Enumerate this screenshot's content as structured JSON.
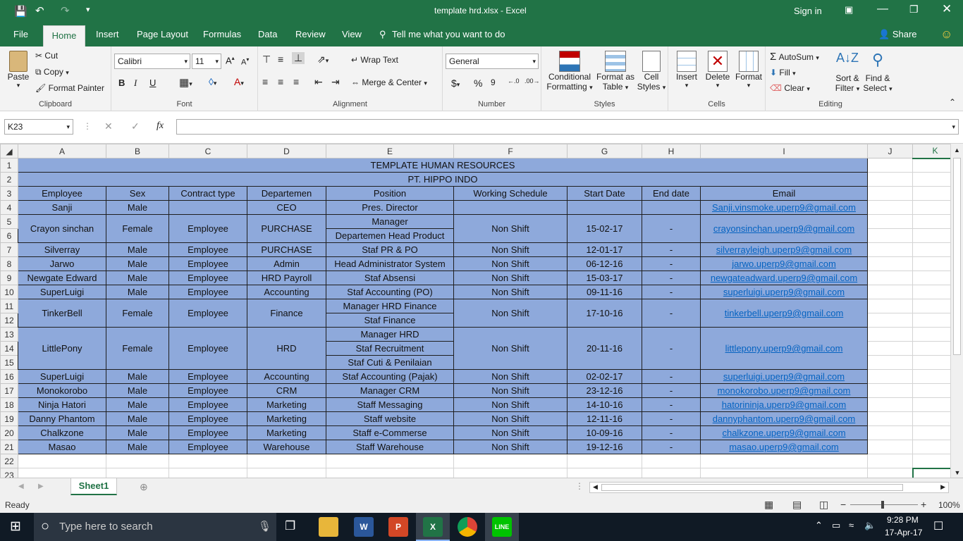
{
  "window": {
    "title": "template hrd.xlsx  -  Excel",
    "sign_in": "Sign in"
  },
  "tabs": [
    "File",
    "Home",
    "Insert",
    "Page Layout",
    "Formulas",
    "Data",
    "Review",
    "View"
  ],
  "tell_me": "Tell me what you want to do",
  "share": "Share",
  "ribbon": {
    "clipboard": {
      "label": "Clipboard",
      "paste": "Paste",
      "cut": "Cut",
      "copy": "Copy",
      "format_painter": "Format Painter"
    },
    "font": {
      "label": "Font",
      "name": "Calibri",
      "size": "11",
      "bold": "B",
      "italic": "I",
      "underline": "U"
    },
    "alignment": {
      "label": "Alignment",
      "wrap": "Wrap Text",
      "merge": "Merge & Center"
    },
    "number": {
      "label": "Number",
      "format": "General",
      "currency": "$",
      "percent": "%",
      "comma": "9"
    },
    "styles": {
      "label": "Styles",
      "conditional": "Conditional",
      "conditional2": "Formatting",
      "format_table": "Format as",
      "format_table2": "Table",
      "cell_styles": "Cell",
      "cell_styles2": "Styles"
    },
    "cells": {
      "label": "Cells",
      "insert": "Insert",
      "delete": "Delete",
      "format": "Format"
    },
    "editing": {
      "label": "Editing",
      "autosum": "AutoSum",
      "fill": "Fill",
      "clear": "Clear",
      "sort": "Sort &",
      "sort2": "Filter",
      "find": "Find &",
      "find2": "Select"
    }
  },
  "namebox": "K23",
  "fx": "fx",
  "columns": [
    "A",
    "B",
    "C",
    "D",
    "E",
    "F",
    "G",
    "H",
    "I",
    "J",
    "K"
  ],
  "sheet": {
    "title": "TEMPLATE HUMAN RESOURCES",
    "company": "PT. HIPPO INDO",
    "headers": [
      "Employee",
      "Sex",
      "Contract type",
      "Departemen",
      "Position",
      "Working Schedule",
      "Start Date",
      "End date",
      "Email"
    ],
    "r4": [
      "Sanji",
      "Male",
      "",
      "CEO",
      "Pres. Director",
      "",
      "",
      "",
      "Sanji.vinsmoke.uperp9@gmail.com"
    ],
    "r5": [
      "Crayon sinchan",
      "Female",
      "Employee",
      "PURCHASE",
      "Manager",
      "Non Shift",
      "15-02-17",
      "-",
      "crayonsinchan.uperp9@gmail.com"
    ],
    "r6pos": "Departemen Head Product",
    "r7": [
      "Silverray",
      "Male",
      "Employee",
      "PURCHASE",
      "Staf PR & PO",
      "Non Shift",
      "12-01-17",
      "-",
      "silverrayleigh.uperp9@gmail.com"
    ],
    "r8": [
      "Jarwo",
      "Male",
      "Employee",
      "Admin",
      "Head Administrator System",
      "Non Shift",
      "06-12-16",
      "-",
      "jarwo.uperp9@gmail.com"
    ],
    "r9": [
      "Newgate Edward",
      "Male",
      "Employee",
      "HRD Payroll",
      "Staf Absensi",
      "Non Shift",
      "15-03-17",
      "-",
      "newgateadward.uperp9@gmail.com"
    ],
    "r10": [
      "SuperLuigi",
      "Male",
      "Employee",
      "Accounting",
      "Staf Accounting (PO)",
      "Non Shift",
      "09-11-16",
      "-",
      "superluigi.uperp9@gmail.com"
    ],
    "r11": [
      "TinkerBell",
      "Female",
      "Employee",
      "Finance",
      "Manager HRD Finance",
      "Non Shift",
      "17-10-16",
      "-",
      "tinkerbell.uperp9@gmail.com"
    ],
    "r12pos": "Staf Finance",
    "r13": [
      "LittlePony",
      "Female",
      "Employee",
      "HRD",
      "Manager HRD",
      "Non Shift",
      "20-11-16",
      "-",
      "littlepony.uperp9@gmail.com"
    ],
    "r14pos": "Staf Recruitment",
    "r15pos": "Staf Cuti & Penilaian",
    "r16": [
      "SuperLuigi",
      "Male",
      "Employee",
      "Accounting",
      "Staf Accounting (Pajak)",
      "Non Shift",
      "02-02-17",
      "-",
      "superluigi.uperp9@gmail.com"
    ],
    "r17": [
      "Monokorobo",
      "Male",
      "Employee",
      "CRM",
      "Manager CRM",
      "Non Shift",
      "23-12-16",
      "-",
      "monokorobo.uperp9@gmail.com"
    ],
    "r18": [
      "Ninja Hatori",
      "Male",
      "Employee",
      "Marketing",
      "Staff Messaging",
      "Non Shift",
      "14-10-16",
      "-",
      "hatorininja.uperp9@gmail.com"
    ],
    "r19": [
      "Danny Phantom",
      "Male",
      "Employee",
      "Marketing",
      "Staff website",
      "Non Shift",
      "12-11-16",
      "-",
      "dannyphantom.uperp9@gmail.com"
    ],
    "r20": [
      "Chalkzone",
      "Male",
      "Employee",
      "Marketing",
      "Staff e-Commerse",
      "Non Shift",
      "10-09-16",
      "-",
      "chalkzone.uperp9@gmail.com"
    ],
    "r21": [
      "Masao",
      "Male",
      "Employee",
      "Warehouse",
      "Staff Warehouse",
      "Non Shift",
      "19-12-16",
      "-",
      "masao.uperp9@gmail.com"
    ]
  },
  "sheet_tab": "Sheet1",
  "status": {
    "ready": "Ready",
    "zoom": "100%"
  },
  "taskbar": {
    "search": "Type here to search",
    "time": "9:28 PM",
    "date": "17-Apr-17"
  },
  "colors": {
    "excel_green": "#217346",
    "cell_fill": "#8ea9db",
    "link": "#0563c1"
  }
}
